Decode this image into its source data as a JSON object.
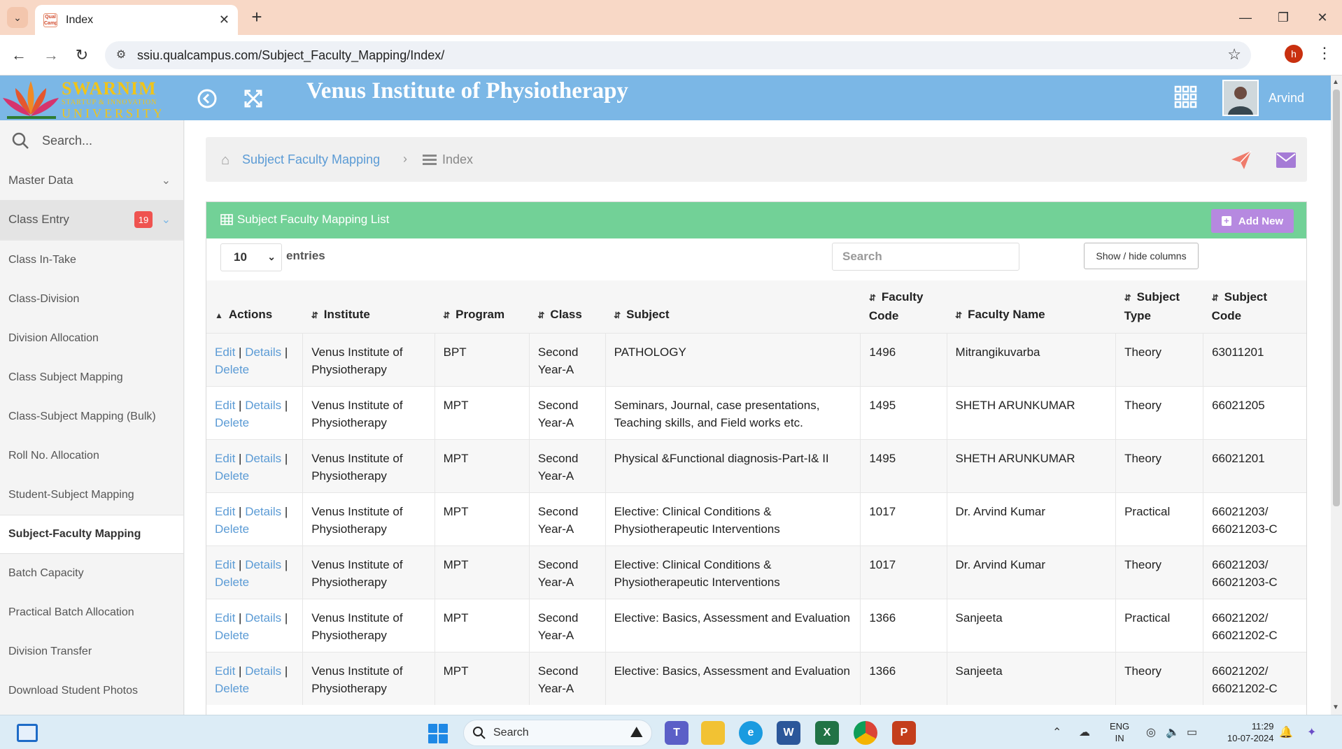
{
  "browser": {
    "tab_title": "Index",
    "favicon_text": "Qual Campus",
    "url": "ssiu.qualcampus.com/Subject_Faculty_Mapping/Index/",
    "profile_initial": "h"
  },
  "header": {
    "logo": {
      "name": "SWARNIM",
      "sub": "STARTUP & INNOVATION",
      "uni": "UNIVERSITY"
    },
    "title": "Venus Institute of Physiotherapy",
    "user_name": "Arvind"
  },
  "sidebar": {
    "search_placeholder": "Search...",
    "groups": [
      {
        "label": "Master Data"
      },
      {
        "label": "Class Entry",
        "badge": "19"
      }
    ],
    "items": [
      {
        "label": "Class In-Take"
      },
      {
        "label": "Class-Division"
      },
      {
        "label": "Division Allocation"
      },
      {
        "label": "Class Subject Mapping"
      },
      {
        "label": "Class-Subject Mapping (Bulk)"
      },
      {
        "label": "Roll No. Allocation"
      },
      {
        "label": "Student-Subject Mapping"
      },
      {
        "label": "Subject-Faculty Mapping",
        "active": true
      },
      {
        "label": "Batch Capacity"
      },
      {
        "label": "Practical Batch Allocation"
      },
      {
        "label": "Division Transfer"
      },
      {
        "label": "Download Student Photos"
      }
    ]
  },
  "breadcrumb": {
    "parent": "Subject Faculty Mapping",
    "current": "Index"
  },
  "panel": {
    "title": "Subject Faculty Mapping List",
    "add_new_label": "Add New",
    "page_length": "10",
    "entries_label": "entries",
    "search_placeholder": "Search",
    "colvis_label": "Show / hide columns"
  },
  "table": {
    "headers": {
      "actions": "Actions",
      "institute": "Institute",
      "program": "Program",
      "class": "Class",
      "subject": "Subject",
      "faculty_code": "Faculty Code",
      "faculty_name": "Faculty Name",
      "subject_type": "Subject Type",
      "subject_code": "Subject Code"
    },
    "action_labels": {
      "edit": "Edit",
      "details": "Details",
      "delete": "Delete",
      "separator": "|"
    },
    "rows": [
      {
        "institute": "Venus Institute of Physiotherapy",
        "program": "BPT",
        "class": "Second Year-A",
        "subject": "PATHOLOGY",
        "faculty_code": "1496",
        "faculty_name": "Mitrangikuvarba",
        "subject_type": "Theory",
        "subject_code": "63011201"
      },
      {
        "institute": "Venus Institute of Physiotherapy",
        "program": "MPT",
        "class": "Second Year-A",
        "subject": "Seminars, Journal, case presentations, Teaching skills, and Field works etc.",
        "faculty_code": "1495",
        "faculty_name": "SHETH ARUNKUMAR",
        "subject_type": "Theory",
        "subject_code": "66021205"
      },
      {
        "institute": "Venus Institute of Physiotherapy",
        "program": "MPT",
        "class": "Second Year-A",
        "subject": "Physical &Functional diagnosis-Part-I& II",
        "faculty_code": "1495",
        "faculty_name": "SHETH ARUNKUMAR",
        "subject_type": "Theory",
        "subject_code": "66021201"
      },
      {
        "institute": "Venus Institute of Physiotherapy",
        "program": "MPT",
        "class": "Second Year-A",
        "subject": "Elective: Clinical Conditions & Physiotherapeutic Interventions",
        "faculty_code": "1017",
        "faculty_name": "Dr. Arvind Kumar",
        "subject_type": "Practical",
        "subject_code": "66021203/ 66021203-C"
      },
      {
        "institute": "Venus Institute of Physiotherapy",
        "program": "MPT",
        "class": "Second Year-A",
        "subject": "Elective: Clinical Conditions & Physiotherapeutic Interventions",
        "faculty_code": "1017",
        "faculty_name": "Dr. Arvind Kumar",
        "subject_type": "Theory",
        "subject_code": "66021203/ 66021203-C"
      },
      {
        "institute": "Venus Institute of Physiotherapy",
        "program": "MPT",
        "class": "Second Year-A",
        "subject": "Elective: Basics, Assessment and Evaluation",
        "faculty_code": "1366",
        "faculty_name": "Sanjeeta",
        "subject_type": "Practical",
        "subject_code": "66021202/ 66021202-C"
      },
      {
        "institute": "Venus Institute of Physiotherapy",
        "program": "MPT",
        "class": "Second Year-A",
        "subject": "Elective: Basics, Assessment and Evaluation",
        "faculty_code": "1366",
        "faculty_name": "Sanjeeta",
        "subject_type": "Theory",
        "subject_code": "66021202/ 66021202-C"
      }
    ]
  },
  "taskbar": {
    "search_label": "Search",
    "lang_line1": "ENG",
    "lang_line2": "IN",
    "time": "11:29",
    "date": "10-07-2024"
  },
  "colors": {
    "header_blue": "#7bb7e6",
    "panel_green": "#72d197",
    "add_new_purple": "#b689e0",
    "link_blue": "#5b9bd5",
    "badge_red": "#ef5350"
  }
}
